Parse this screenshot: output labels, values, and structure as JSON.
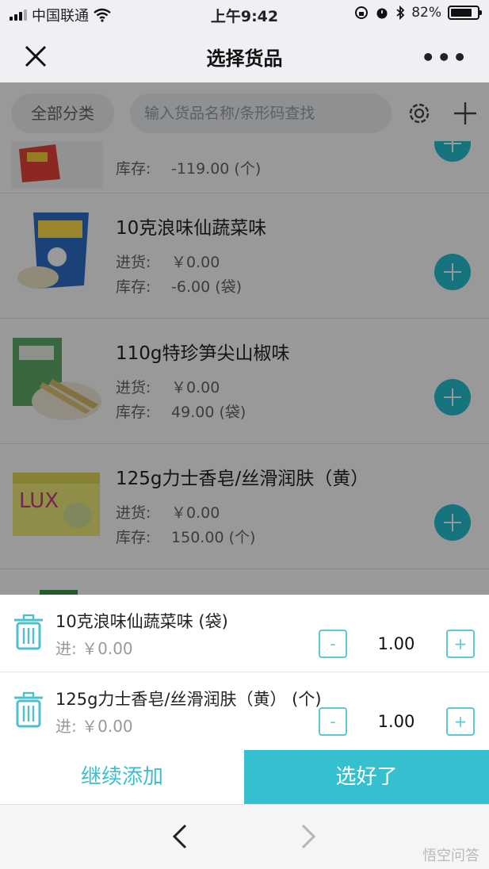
{
  "status_bar": {
    "carrier": "中国联通",
    "time": "上午9:42",
    "battery": "82%",
    "battery_level": 0.82
  },
  "nav": {
    "title": "选择货品"
  },
  "toolbar": {
    "category_label": "全部分类",
    "search_placeholder": "输入货品名称/条形码查找"
  },
  "products": [
    {
      "name": "",
      "stock_label": "库存:",
      "stock_value": "-119.00 (个)"
    },
    {
      "name": "10克浪味仙蔬菜味",
      "purchase_label": "进货:",
      "purchase_value": "￥0.00",
      "stock_label": "库存:",
      "stock_value": "-6.00 (袋)"
    },
    {
      "name": "110g特珍笋尖山椒味",
      "purchase_label": "进货:",
      "purchase_value": "￥0.00",
      "stock_label": "库存:",
      "stock_value": "49.00 (袋)"
    },
    {
      "name": "125g力士香皂/丝滑润肤（黄）",
      "purchase_label": "进货:",
      "purchase_value": "￥0.00",
      "stock_label": "库存:",
      "stock_value": "150.00 (个)"
    }
  ],
  "cart": [
    {
      "name": "10克浪味仙蔬菜味 (袋)",
      "price_label": "进:",
      "price": "￥0.00",
      "qty": "1.00",
      "minus": "-",
      "plus": "+"
    },
    {
      "name": "125g力士香皂/丝滑润肤（黄） (个)",
      "price_label": "进:",
      "price": "￥0.00",
      "qty": "1.00",
      "minus": "-",
      "plus": "+"
    }
  ],
  "actions": {
    "continue_label": "继续添加",
    "done_label": "选好了"
  },
  "watermark": "悟空问答",
  "colors": {
    "accent": "#35c0cf",
    "add_button": "#25c2d4"
  }
}
